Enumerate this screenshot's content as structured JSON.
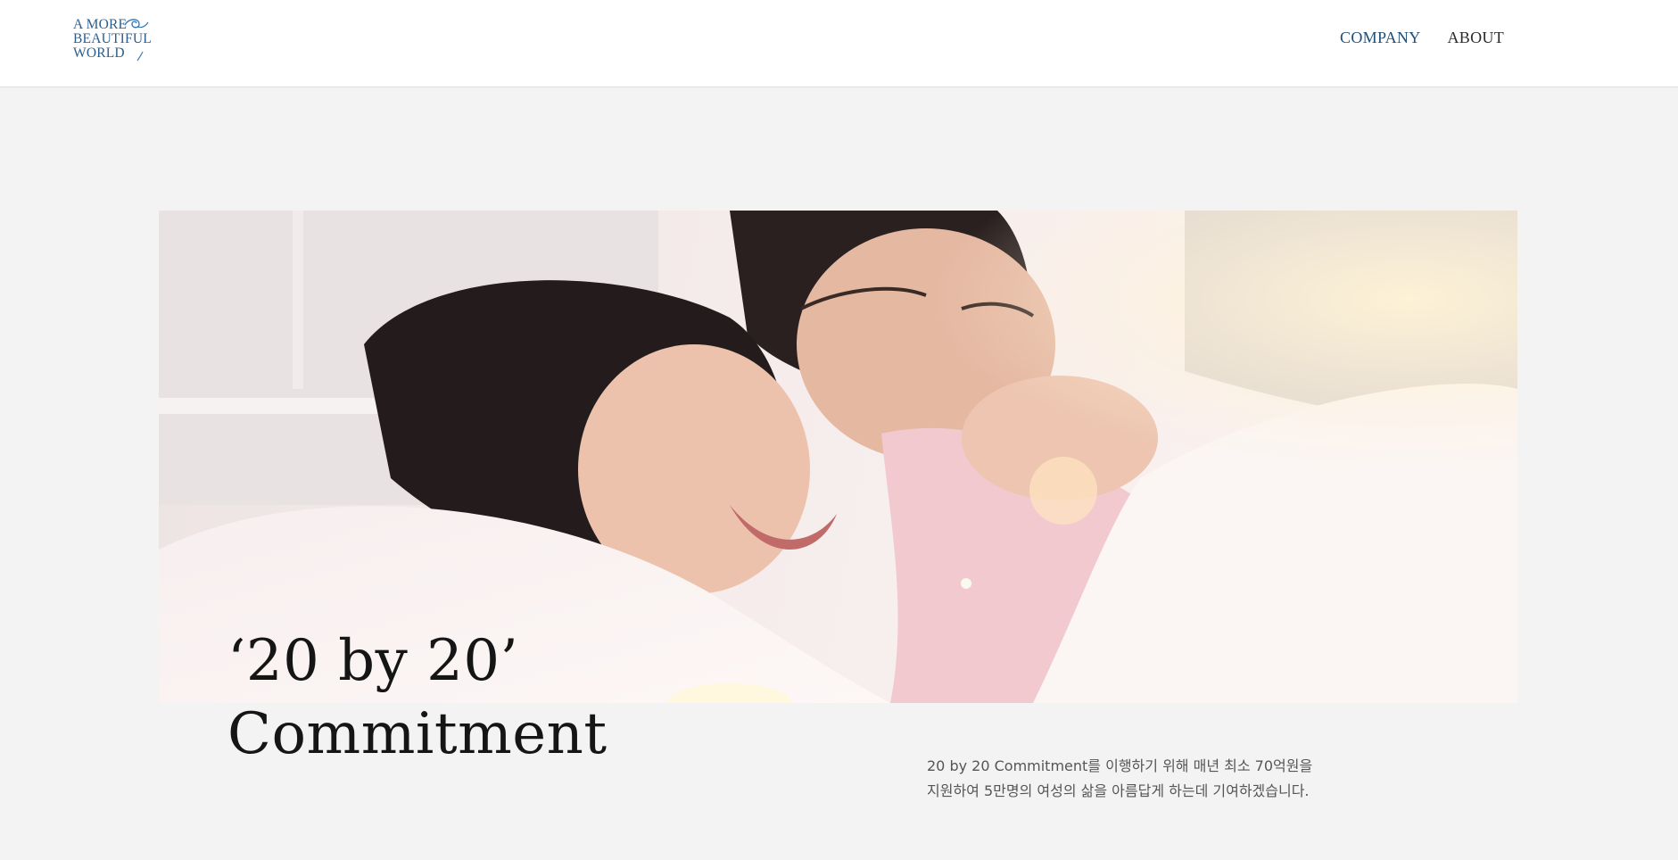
{
  "header": {
    "logo": {
      "line1": "A MORE",
      "line2": "BEAUTIFUL",
      "line3": "WORLD"
    },
    "nav": [
      {
        "label": "COMPANY"
      },
      {
        "label": "ABOUT"
      }
    ]
  },
  "hero": {
    "image_description_icon": "photo-mother-daughter-icon"
  },
  "main": {
    "title_line1": "‘20 by 20’",
    "title_line2": "Commitment",
    "desc_line1": "20 by 20 Commitment를 이행하기 위해 매년 최소 70억원을",
    "desc_line2": "지원하여 5만명의 여성의 삶을 아름답게 하는데 기여하겠습니다."
  },
  "colors": {
    "brand_blue": "#2c5d8f",
    "nav_active": "#1f4e79",
    "background": "#f3f3f3"
  }
}
